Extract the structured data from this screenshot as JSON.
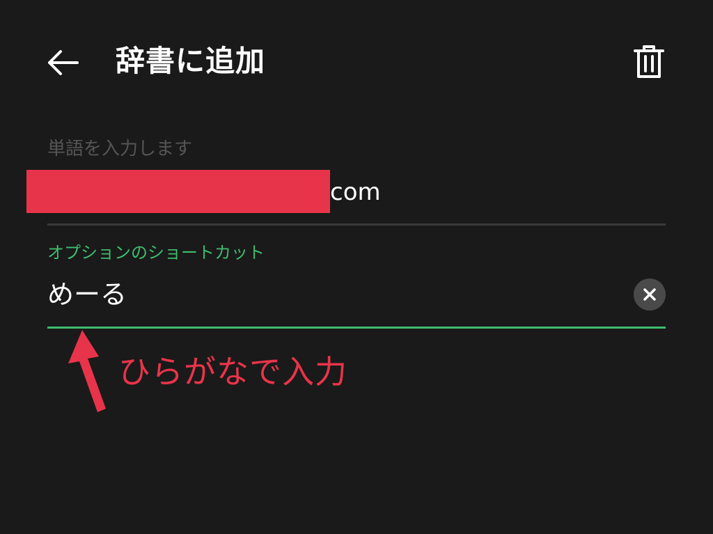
{
  "app_bar": {
    "title": "辞書に追加",
    "back_icon": "arrow-left-icon",
    "delete_icon": "trash-icon"
  },
  "word_field": {
    "label": "単語を入力します",
    "value": "com",
    "redaction_color": "#e8344a"
  },
  "shortcut_field": {
    "label": "オプションのショートカット",
    "value": "めーる",
    "clear_icon": "close-icon"
  },
  "annotation": {
    "text": "ひらがなで入力",
    "color": "#e8344a"
  },
  "colors": {
    "background": "#1a1a1a",
    "accent": "#3dbd6e",
    "text": "#ffffff",
    "hint": "#555555"
  }
}
